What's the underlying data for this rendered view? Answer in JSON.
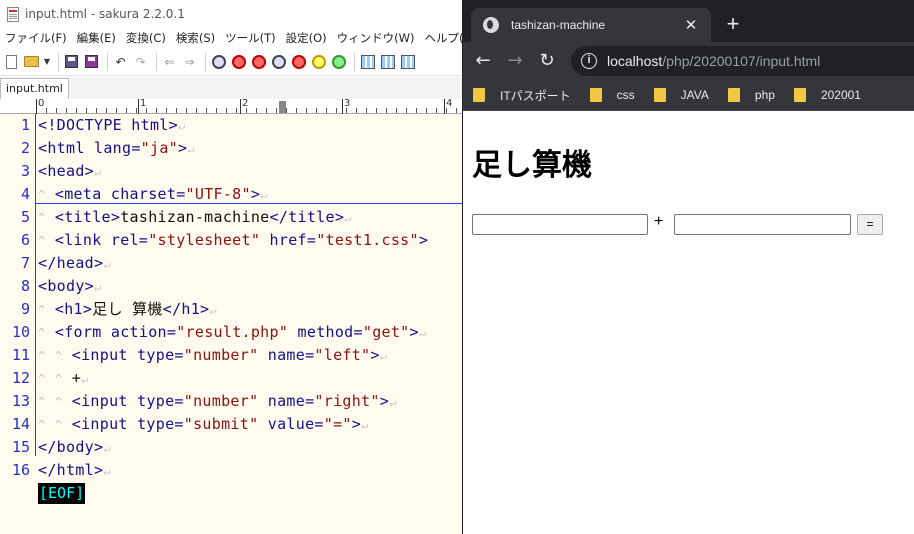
{
  "editor": {
    "title": "input.html - sakura 2.2.0.1",
    "menu": [
      "ファイル(F)",
      "編集(E)",
      "変換(C)",
      "検索(S)",
      "ツール(T)",
      "設定(O)",
      "ウィンドウ(W)",
      "ヘルプ(H)"
    ],
    "tab_label": "input.html",
    "ruler_numbers": [
      "0",
      "1",
      "2",
      "3",
      "4"
    ],
    "line_numbers": [
      "1",
      "2",
      "3",
      "4",
      "5",
      "6",
      "7",
      "8",
      "9",
      "10",
      "11",
      "12",
      "13",
      "14",
      "15",
      "16"
    ],
    "code": {
      "l1_tag": "<!DOCTYPE html>",
      "l2_a": "<html",
      "l2_b": "lang=",
      "l2_c": "\"ja\"",
      "l2_d": ">",
      "l3": "<head>",
      "l4_a": "<meta",
      "l4_b": "charset=",
      "l4_c": "\"UTF-8\"",
      "l4_d": ">",
      "l5_a": "<title>",
      "l5_b": "tashizan-machine",
      "l5_c": "</title>",
      "l6_a": "<link",
      "l6_b": "rel=",
      "l6_c": "\"stylesheet\"",
      "l6_d": "href=",
      "l6_e": "\"test1.css\"",
      "l6_f": ">",
      "l7": "</head>",
      "l8": "<body>",
      "l9_a": "<h1>",
      "l9_b": "足し 算機",
      "l9_c": "</h1>",
      "l10_a": "<form",
      "l10_b": "action=",
      "l10_c": "\"result.php\"",
      "l10_d": "method=",
      "l10_e": "\"get\"",
      "l10_f": ">",
      "l11_a": "<input",
      "l11_b": "type=",
      "l11_c": "\"number\"",
      "l11_d": "name=",
      "l11_e": "\"left\"",
      "l11_f": ">",
      "l12": "+",
      "l13_a": "<input",
      "l13_b": "type=",
      "l13_c": "\"number\"",
      "l13_d": "name=",
      "l13_e": "\"right\"",
      "l13_f": ">",
      "l14_a": "<input",
      "l14_b": "type=",
      "l14_c": "\"submit\"",
      "l14_d": "value=",
      "l14_e": "\"=\"",
      "l14_f": ">",
      "l15": "</body>",
      "l16": "</html>"
    },
    "eof": "[EOF]",
    "return_mark": "↵",
    "indent_mark": "^"
  },
  "browser": {
    "tab_title": "tashizan-machine",
    "tab_close": "✕",
    "new_tab": "+",
    "url_host": "localhost",
    "url_path": "/php/20200107/input.html",
    "info_glyph": "i",
    "bookmarks": [
      "ITパスポート",
      "css",
      "JAVA",
      "php",
      "202001"
    ],
    "page": {
      "heading": "足し算機",
      "plus": "+",
      "submit_value": "="
    }
  },
  "colors": {
    "editor_bg": "#fffbef",
    "tag_color": "#11118a",
    "string_color": "#8a1111",
    "line_number_color": "#2630c8",
    "eof_fg": "#00ffff",
    "chrome_dark": "#202124",
    "chrome_toolbar": "#35363a"
  }
}
